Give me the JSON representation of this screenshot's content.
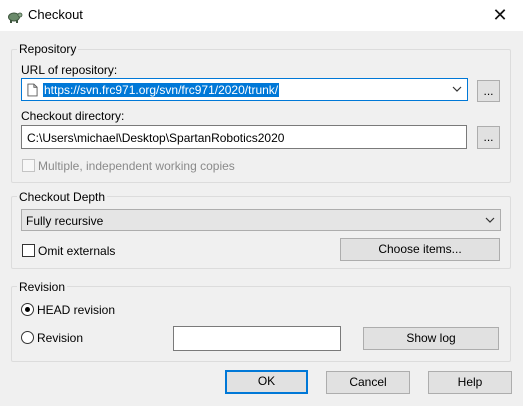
{
  "window": {
    "title": "Checkout",
    "close_glyph": "✕"
  },
  "repository": {
    "group_label": "Repository",
    "url_label": "URL of repository:",
    "url_value": "https://svn.frc971.org/svn/frc971/2020/trunk/",
    "browse_label": "...",
    "dir_label": "Checkout directory:",
    "dir_value": "C:\\Users\\michael\\Desktop\\SpartanRobotics2020",
    "dir_browse_label": "...",
    "multiple_label": "Multiple, independent working copies",
    "multiple_checked": false,
    "multiple_enabled": false
  },
  "depth": {
    "group_label": "Checkout Depth",
    "selected": "Fully recursive",
    "omit_label": "Omit externals",
    "omit_checked": false,
    "choose_label": "Choose items..."
  },
  "revision": {
    "group_label": "Revision",
    "head_label": "HEAD revision",
    "head_selected": true,
    "revision_label": "Revision",
    "revision_value": "",
    "show_log_label": "Show log"
  },
  "buttons": {
    "ok": "OK",
    "cancel": "Cancel",
    "help": "Help"
  },
  "icons": {
    "app": "tortoise-icon",
    "url_file": "document-icon",
    "dropdown": "chevron-down-icon"
  },
  "colors": {
    "accent": "#0078d7",
    "dialog_bg": "#f0f0f0"
  }
}
